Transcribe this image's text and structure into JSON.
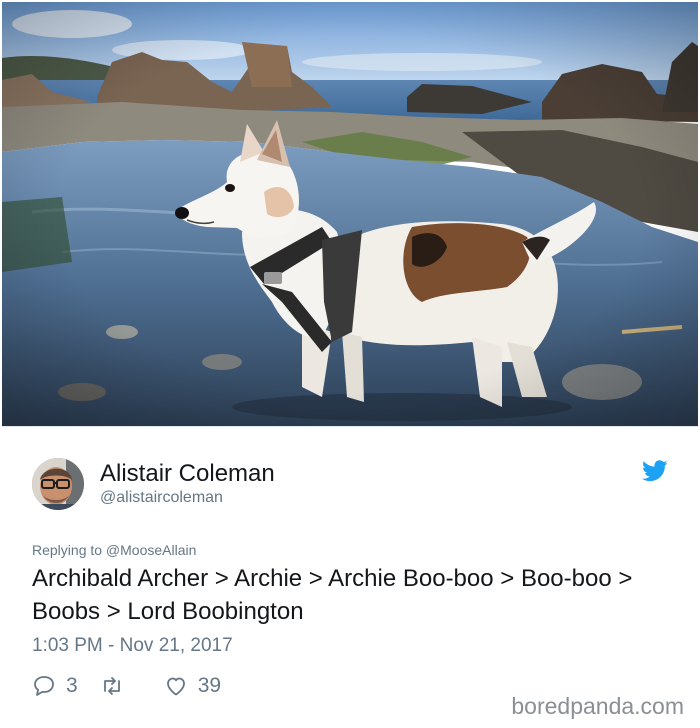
{
  "tweet": {
    "author_name": "Alistair Coleman",
    "author_handle": "@alistaircoleman",
    "replying_to": "Replying to @MooseAllain",
    "text": "Archibald Archer > Archie > Archie Boo-boo > Boo-boo > Boobs > Lord Boobington",
    "timestamp": "1:03 PM - Nov 21, 2017",
    "reply_count": "3",
    "retweet_count": "",
    "like_count": "39",
    "brand_icon": "twitter-bird-icon",
    "brand_color": "#1da1f2"
  },
  "watermark": "boredpanda.com",
  "colors": {
    "secondary_text": "#657786",
    "primary_text": "#14171a"
  }
}
